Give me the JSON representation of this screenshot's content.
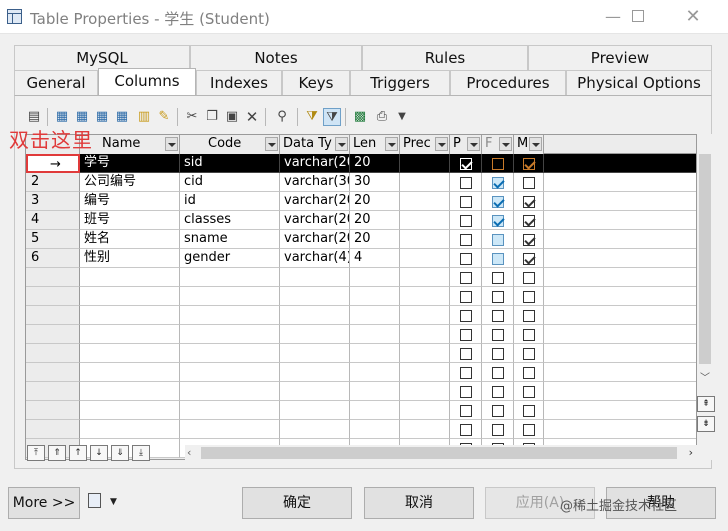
{
  "window": {
    "title": "Table Properties - 学生 (Student)",
    "min_icon": "minimize-icon",
    "max_icon": "maximize-icon",
    "close_icon": "close-icon"
  },
  "tabs_row1": [
    "MySQL",
    "Notes",
    "Rules",
    "Preview"
  ],
  "tabs_row2": [
    "General",
    "Columns",
    "Indexes",
    "Keys",
    "Triggers",
    "Procedures",
    "Physical Options"
  ],
  "active_tab": "Columns",
  "annotation": "双击这里",
  "grid": {
    "headers": [
      "",
      "Name",
      "Code",
      "Data Ty",
      "Len",
      "Prec",
      "P",
      "F",
      "M"
    ],
    "rows": [
      {
        "num": "→",
        "name": "学号",
        "code": "sid",
        "type": "varchar(20",
        "len": "20",
        "prec": "",
        "p": true,
        "f": false,
        "m": true,
        "selected": true
      },
      {
        "num": "2",
        "name": "公司编号",
        "code": "cid",
        "type": "varchar(30",
        "len": "30",
        "prec": "",
        "p": false,
        "f": true,
        "m": false,
        "selected": false
      },
      {
        "num": "3",
        "name": "编号",
        "code": "id",
        "type": "varchar(20",
        "len": "20",
        "prec": "",
        "p": false,
        "f": true,
        "m": true,
        "selected": false
      },
      {
        "num": "4",
        "name": "班号",
        "code": "classes",
        "type": "varchar(20",
        "len": "20",
        "prec": "",
        "p": false,
        "f": true,
        "m": true,
        "selected": false
      },
      {
        "num": "5",
        "name": "姓名",
        "code": "sname",
        "type": "varchar(20",
        "len": "20",
        "prec": "",
        "p": false,
        "f": false,
        "m": true,
        "selected": false
      },
      {
        "num": "6",
        "name": "性别",
        "code": "gender",
        "type": "varchar(4)",
        "len": "4",
        "prec": "",
        "p": false,
        "f": false,
        "m": true,
        "selected": false
      }
    ],
    "empty_rows": 10
  },
  "toolbar_icons": [
    "properties-icon",
    "insert-row-icon",
    "add-row-icon",
    "add-columns-icon",
    "reuse-columns-icon",
    "new-domain-icon",
    "rename-icon",
    "cut-icon",
    "copy-icon",
    "paste-icon",
    "delete-icon",
    "find-icon",
    "filter-icon",
    "customize-columns-icon",
    "excel-export-icon",
    "print-icon",
    "dropdown-caret-icon"
  ],
  "buttons": {
    "more": "More >>",
    "ok": "确定",
    "cancel": "取消",
    "apply": "应用(A)",
    "help": "帮助"
  },
  "watermark": "@稀土掘金技术社区",
  "colors": {
    "selection": "#000000",
    "annotation": "#e03a3a",
    "f_checkbox": "#cde8f8"
  }
}
